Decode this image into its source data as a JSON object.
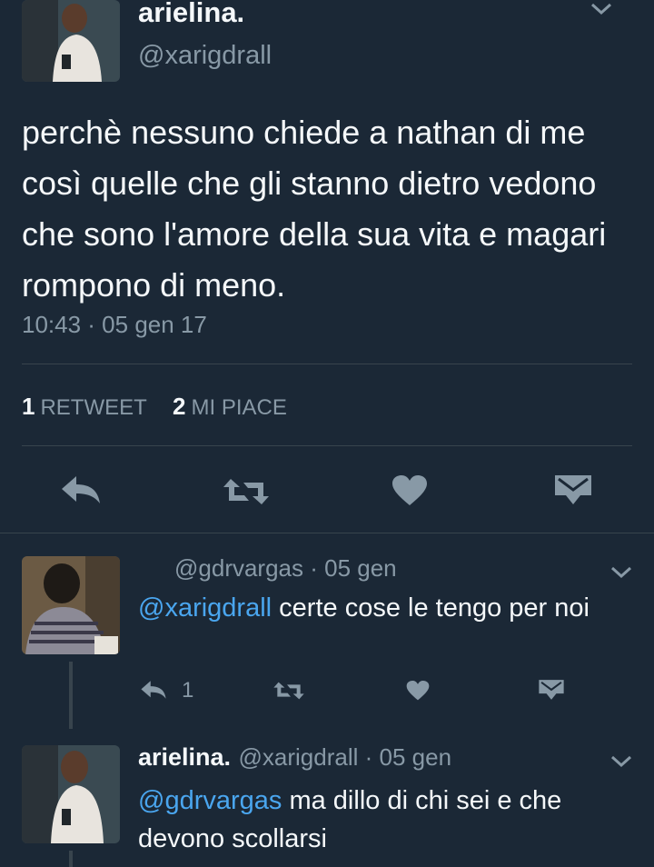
{
  "main_tweet": {
    "display_name": "arielina.",
    "handle": "@xarigdrall",
    "text": "perchè nessuno chiede a nathan di me così quelle che gli stanno dietro vedono che sono l'amore della sua vita e magari rompono di meno.",
    "timestamp": "10:43 · 05 gen 17",
    "retweet_count": "1",
    "retweet_label": "RETWEET",
    "like_count": "2",
    "like_label": "MI PIACE"
  },
  "replies": [
    {
      "handle_time": "@gdrvargas · 05 gen",
      "mention": "@xarigdrall",
      "text": " certe cose le tengo per noi",
      "reply_count": "1"
    },
    {
      "display_name": "arielina.",
      "handle_time": "@xarigdrall · 05 gen",
      "mention": "@gdrvargas",
      "text": " ma dillo di chi sei e che devono scollarsi"
    }
  ],
  "colors": {
    "background": "#1b2836",
    "divider": "#38444d",
    "secondary_text": "#8899a6",
    "link": "#4aa6ef"
  }
}
